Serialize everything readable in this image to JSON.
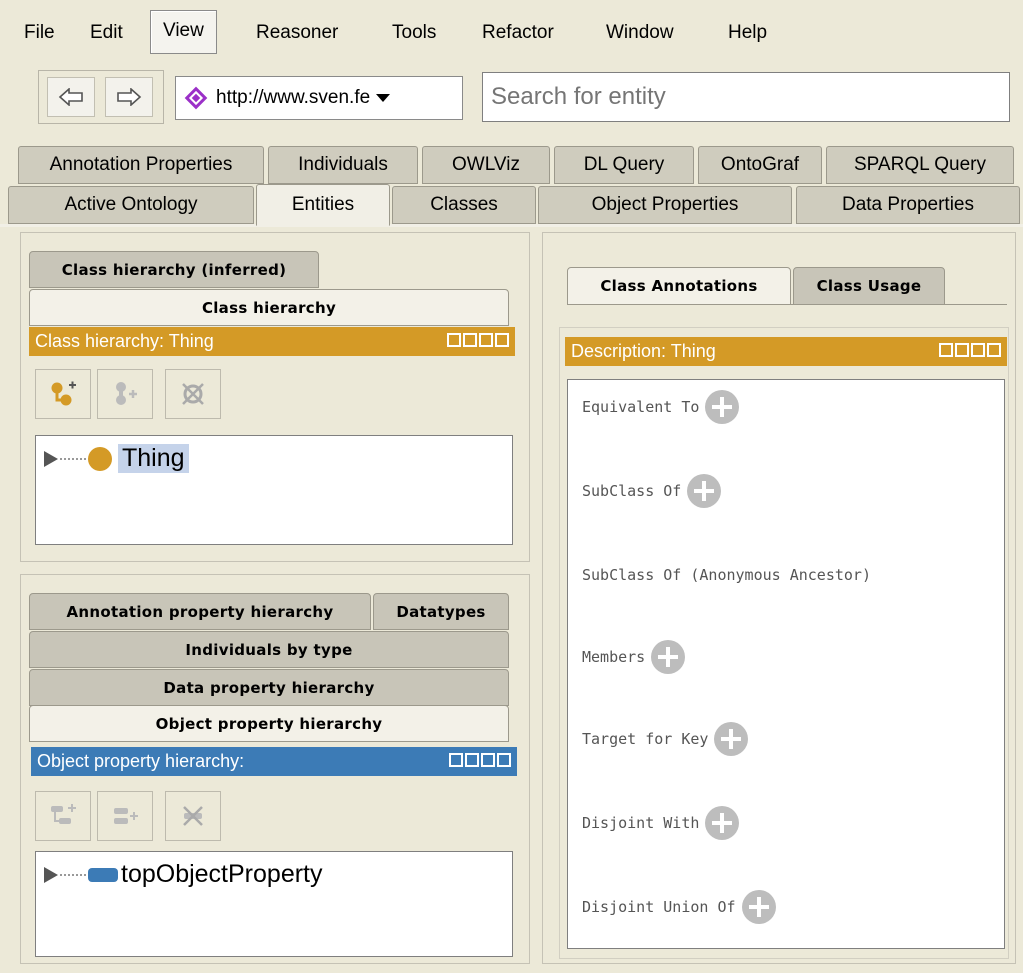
{
  "menu": [
    "File",
    "Edit",
    "View",
    "Reasoner",
    "Tools",
    "Refactor",
    "Window",
    "Help"
  ],
  "toolbar": {
    "ontology_url": "http://www.sven.fe",
    "search_placeholder": "Search for entity"
  },
  "tabs_row1": [
    "Annotation Properties",
    "Individuals",
    "OWLViz",
    "DL Query",
    "OntoGraf",
    "SPARQL Query"
  ],
  "tabs_row2": [
    "Active Ontology",
    "Entities",
    "Classes",
    "Object Properties",
    "Data Properties"
  ],
  "selected_tab": "Entities",
  "class_panel": {
    "tabs": [
      "Class hierarchy (inferred)",
      "Class hierarchy"
    ],
    "title": "Class hierarchy: Thing",
    "root": "Thing"
  },
  "property_panel": {
    "tabs": [
      "Annotation property hierarchy",
      "Datatypes",
      "Individuals by type",
      "Data property hierarchy",
      "Object property hierarchy"
    ],
    "title": "Object property hierarchy:",
    "root": "topObjectProperty"
  },
  "right_panel": {
    "tabs": [
      "Class Annotations",
      "Class Usage"
    ],
    "title": "Description: Thing",
    "sections": [
      "Equivalent To",
      "SubClass Of",
      "SubClass Of (Anonymous Ancestor)",
      "Members",
      "Target for Key",
      "Disjoint With",
      "Disjoint Union Of"
    ]
  },
  "colors": {
    "class_accent": "#d49a26",
    "property_accent": "#3c7bb6",
    "selection": "#c5d3ea"
  }
}
